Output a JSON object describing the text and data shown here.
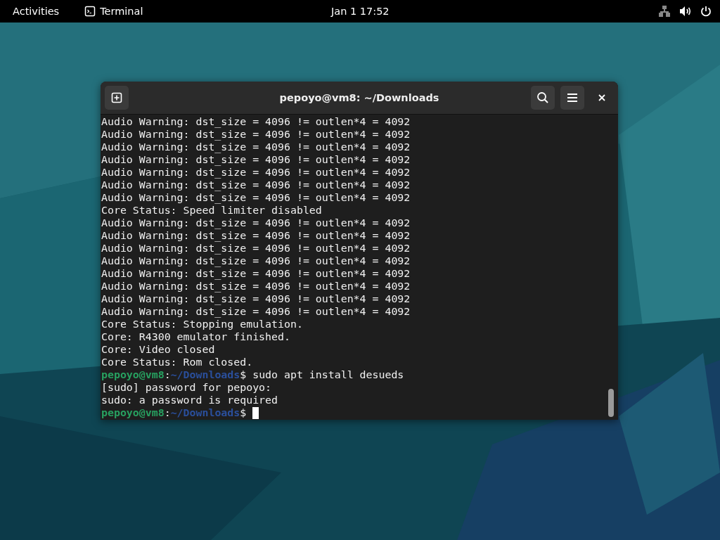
{
  "top_bar": {
    "activities": "Activities",
    "app_name": "Terminal",
    "clock": "Jan 1  17:52"
  },
  "window": {
    "title": "pepoyo@vm8: ~/Downloads"
  },
  "terminal": {
    "lines": [
      {
        "kind": "output",
        "text": "Audio Warning: dst_size = 4096 != outlen*4 = 4092"
      },
      {
        "kind": "output",
        "text": "Audio Warning: dst_size = 4096 != outlen*4 = 4092"
      },
      {
        "kind": "output",
        "text": "Audio Warning: dst_size = 4096 != outlen*4 = 4092"
      },
      {
        "kind": "output",
        "text": "Audio Warning: dst_size = 4096 != outlen*4 = 4092"
      },
      {
        "kind": "output",
        "text": "Audio Warning: dst_size = 4096 != outlen*4 = 4092"
      },
      {
        "kind": "output",
        "text": "Audio Warning: dst_size = 4096 != outlen*4 = 4092"
      },
      {
        "kind": "output",
        "text": "Audio Warning: dst_size = 4096 != outlen*4 = 4092"
      },
      {
        "kind": "output",
        "text": "Core Status: Speed limiter disabled"
      },
      {
        "kind": "output",
        "text": "Audio Warning: dst_size = 4096 != outlen*4 = 4092"
      },
      {
        "kind": "output",
        "text": "Audio Warning: dst_size = 4096 != outlen*4 = 4092"
      },
      {
        "kind": "output",
        "text": "Audio Warning: dst_size = 4096 != outlen*4 = 4092"
      },
      {
        "kind": "output",
        "text": "Audio Warning: dst_size = 4096 != outlen*4 = 4092"
      },
      {
        "kind": "output",
        "text": "Audio Warning: dst_size = 4096 != outlen*4 = 4092"
      },
      {
        "kind": "output",
        "text": "Audio Warning: dst_size = 4096 != outlen*4 = 4092"
      },
      {
        "kind": "output",
        "text": "Audio Warning: dst_size = 4096 != outlen*4 = 4092"
      },
      {
        "kind": "output",
        "text": "Audio Warning: dst_size = 4096 != outlen*4 = 4092"
      },
      {
        "kind": "output",
        "text": "Core Status: Stopping emulation."
      },
      {
        "kind": "output",
        "text": "Core: R4300 emulator finished."
      },
      {
        "kind": "output",
        "text": "Core: Video closed"
      },
      {
        "kind": "output",
        "text": "Core Status: Rom closed."
      },
      {
        "kind": "prompt",
        "user": "pepoyo@vm8",
        "separator": ":",
        "path": "~/Downloads",
        "command": "$ sudo apt install desueds",
        "cursor": false
      },
      {
        "kind": "output",
        "text": "[sudo] password for pepoyo:"
      },
      {
        "kind": "output",
        "text": "sudo: a password is required"
      },
      {
        "kind": "prompt",
        "user": "pepoyo@vm8",
        "separator": ":",
        "path": "~/Downloads",
        "command": "$",
        "cursor": true
      }
    ]
  }
}
